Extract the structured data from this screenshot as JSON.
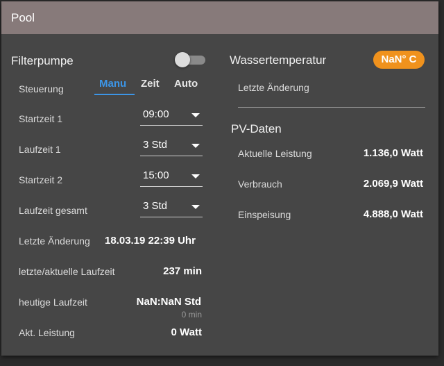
{
  "card": {
    "title": "Pool"
  },
  "filter": {
    "heading": "Filterpumpe",
    "steuerung_label": "Steuerung",
    "tabs": [
      "Manu",
      "Zeit",
      "Auto"
    ],
    "rows": [
      {
        "label": "Startzeit 1",
        "value": "09:00"
      },
      {
        "label": "Laufzeit 1",
        "value": "3 Std"
      },
      {
        "label": "Startzeit 2",
        "value": "15:00"
      },
      {
        "label": "Laufzeit gesamt",
        "value": "3 Std"
      }
    ],
    "letzte_label": "Letzte Änderung",
    "letzte_value": "18.03.19 22:39 Uhr",
    "laufzeit_label": "letzte/aktuelle Laufzeit",
    "laufzeit_value": "237 min",
    "heutige_label": "heutige Laufzeit",
    "heutige_value": "NaN:NaN Std",
    "heutige_sub": "0 min",
    "leistung_label": "Akt. Leistung",
    "leistung_value": "0 Watt"
  },
  "wasser": {
    "heading": "Wassertemperatur",
    "badge": "NaN° C",
    "letzte_label": "Letzte Änderung"
  },
  "pv": {
    "heading": "PV-Daten",
    "rows": [
      {
        "label": "Aktuelle Leistung",
        "value": "1.136,0 Watt"
      },
      {
        "label": "Verbrauch",
        "value": "2.069,9 Watt"
      },
      {
        "label": "Einspeisung",
        "value": "4.888,0 Watt"
      }
    ]
  },
  "colors": {
    "header": "#877a7a",
    "accent": "#3c95e6",
    "badge": "#f0921d",
    "card": "#464646"
  }
}
